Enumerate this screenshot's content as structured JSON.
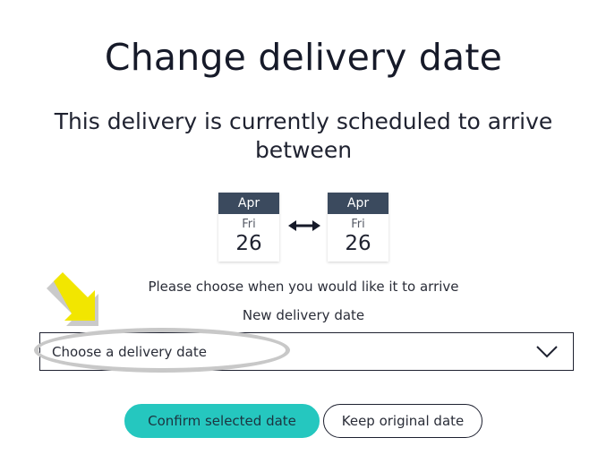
{
  "header": {
    "title": "Change delivery date",
    "subtitle": "This delivery is currently scheduled to arrive between"
  },
  "schedule": {
    "start": {
      "month": "Apr",
      "weekday": "Fri",
      "day": "26"
    },
    "end": {
      "month": "Apr",
      "weekday": "Fri",
      "day": "26"
    }
  },
  "form": {
    "instruction": "Please choose when you would like it to arrive",
    "field_label": "New delivery date",
    "select_value": "Choose a delivery date"
  },
  "buttons": {
    "confirm_label": "Confirm selected date",
    "keep_label": "Keep original date"
  },
  "colors": {
    "accent": "#25c7bf",
    "month_header": "#3b4a5e",
    "annotation_arrow": "#f2e600",
    "annotation_ellipse": "#c8c8c8"
  },
  "icons": {
    "range": "double-arrow-icon",
    "select": "chevron-down-icon",
    "annotation": "pointer-arrow-icon"
  }
}
